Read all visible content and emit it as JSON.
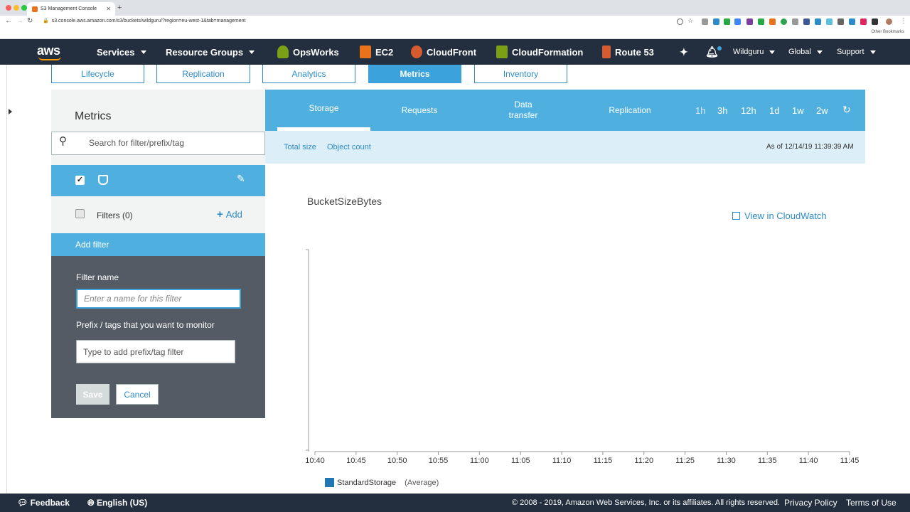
{
  "browser": {
    "tab_title": "S3 Management Console",
    "url": "s3.console.aws.amazon.com/s3/buckets/wildguru/?region=eu-west-1&tab=management",
    "other_bookmarks": "Other Bookmarks"
  },
  "nav": {
    "logo": "aws",
    "services": "Services",
    "resource_groups": "Resource Groups",
    "shortcuts": [
      "OpsWorks",
      "EC2",
      "CloudFront",
      "CloudFormation",
      "Route 53"
    ],
    "account": "Wildguru",
    "region": "Global",
    "support": "Support"
  },
  "subtabs": [
    "Lifecycle",
    "Replication",
    "Analytics",
    "Metrics",
    "Inventory"
  ],
  "left": {
    "title": "Metrics",
    "search_placeholder": "Search for filter/prefix/tag",
    "filters_label": "Filters (0)",
    "add_label": "Add",
    "add_filter_label": "Add filter",
    "filter_name_label": "Filter name",
    "filter_name_placeholder": "Enter a name for this filter",
    "prefix_label": "Prefix / tags that you want to monitor",
    "prefix_placeholder": "Type to add prefix/tag filter",
    "save": "Save",
    "cancel": "Cancel"
  },
  "right": {
    "tabs": [
      "Storage",
      "Requests",
      "Data transfer",
      "Replication"
    ],
    "ranges": [
      "1h",
      "3h",
      "12h",
      "1d",
      "1w",
      "2w"
    ],
    "total_size": "Total size",
    "object_count": "Object count",
    "as_of": "As of 12/14/19 11:39:39 AM",
    "view_cloudwatch": "View in CloudWatch"
  },
  "chart_data": {
    "type": "line",
    "title": "BucketSizeBytes",
    "x": [
      "10:40",
      "10:45",
      "10:50",
      "10:55",
      "11:00",
      "11:05",
      "11:10",
      "11:15",
      "11:20",
      "11:25",
      "11:30",
      "11:35",
      "11:40",
      "11:45"
    ],
    "series": [
      {
        "name": "StandardStorage",
        "values": []
      }
    ],
    "legend_suffix": "(Average)",
    "legend_position": "bottom-left",
    "grid": false,
    "series_color": "#1f77b4"
  },
  "footer": {
    "feedback": "Feedback",
    "language": "English (US)",
    "copyright": "© 2008 - 2019, Amazon Web Services, Inc. or its affiliates. All rights reserved.",
    "privacy": "Privacy Policy",
    "terms": "Terms of Use"
  }
}
